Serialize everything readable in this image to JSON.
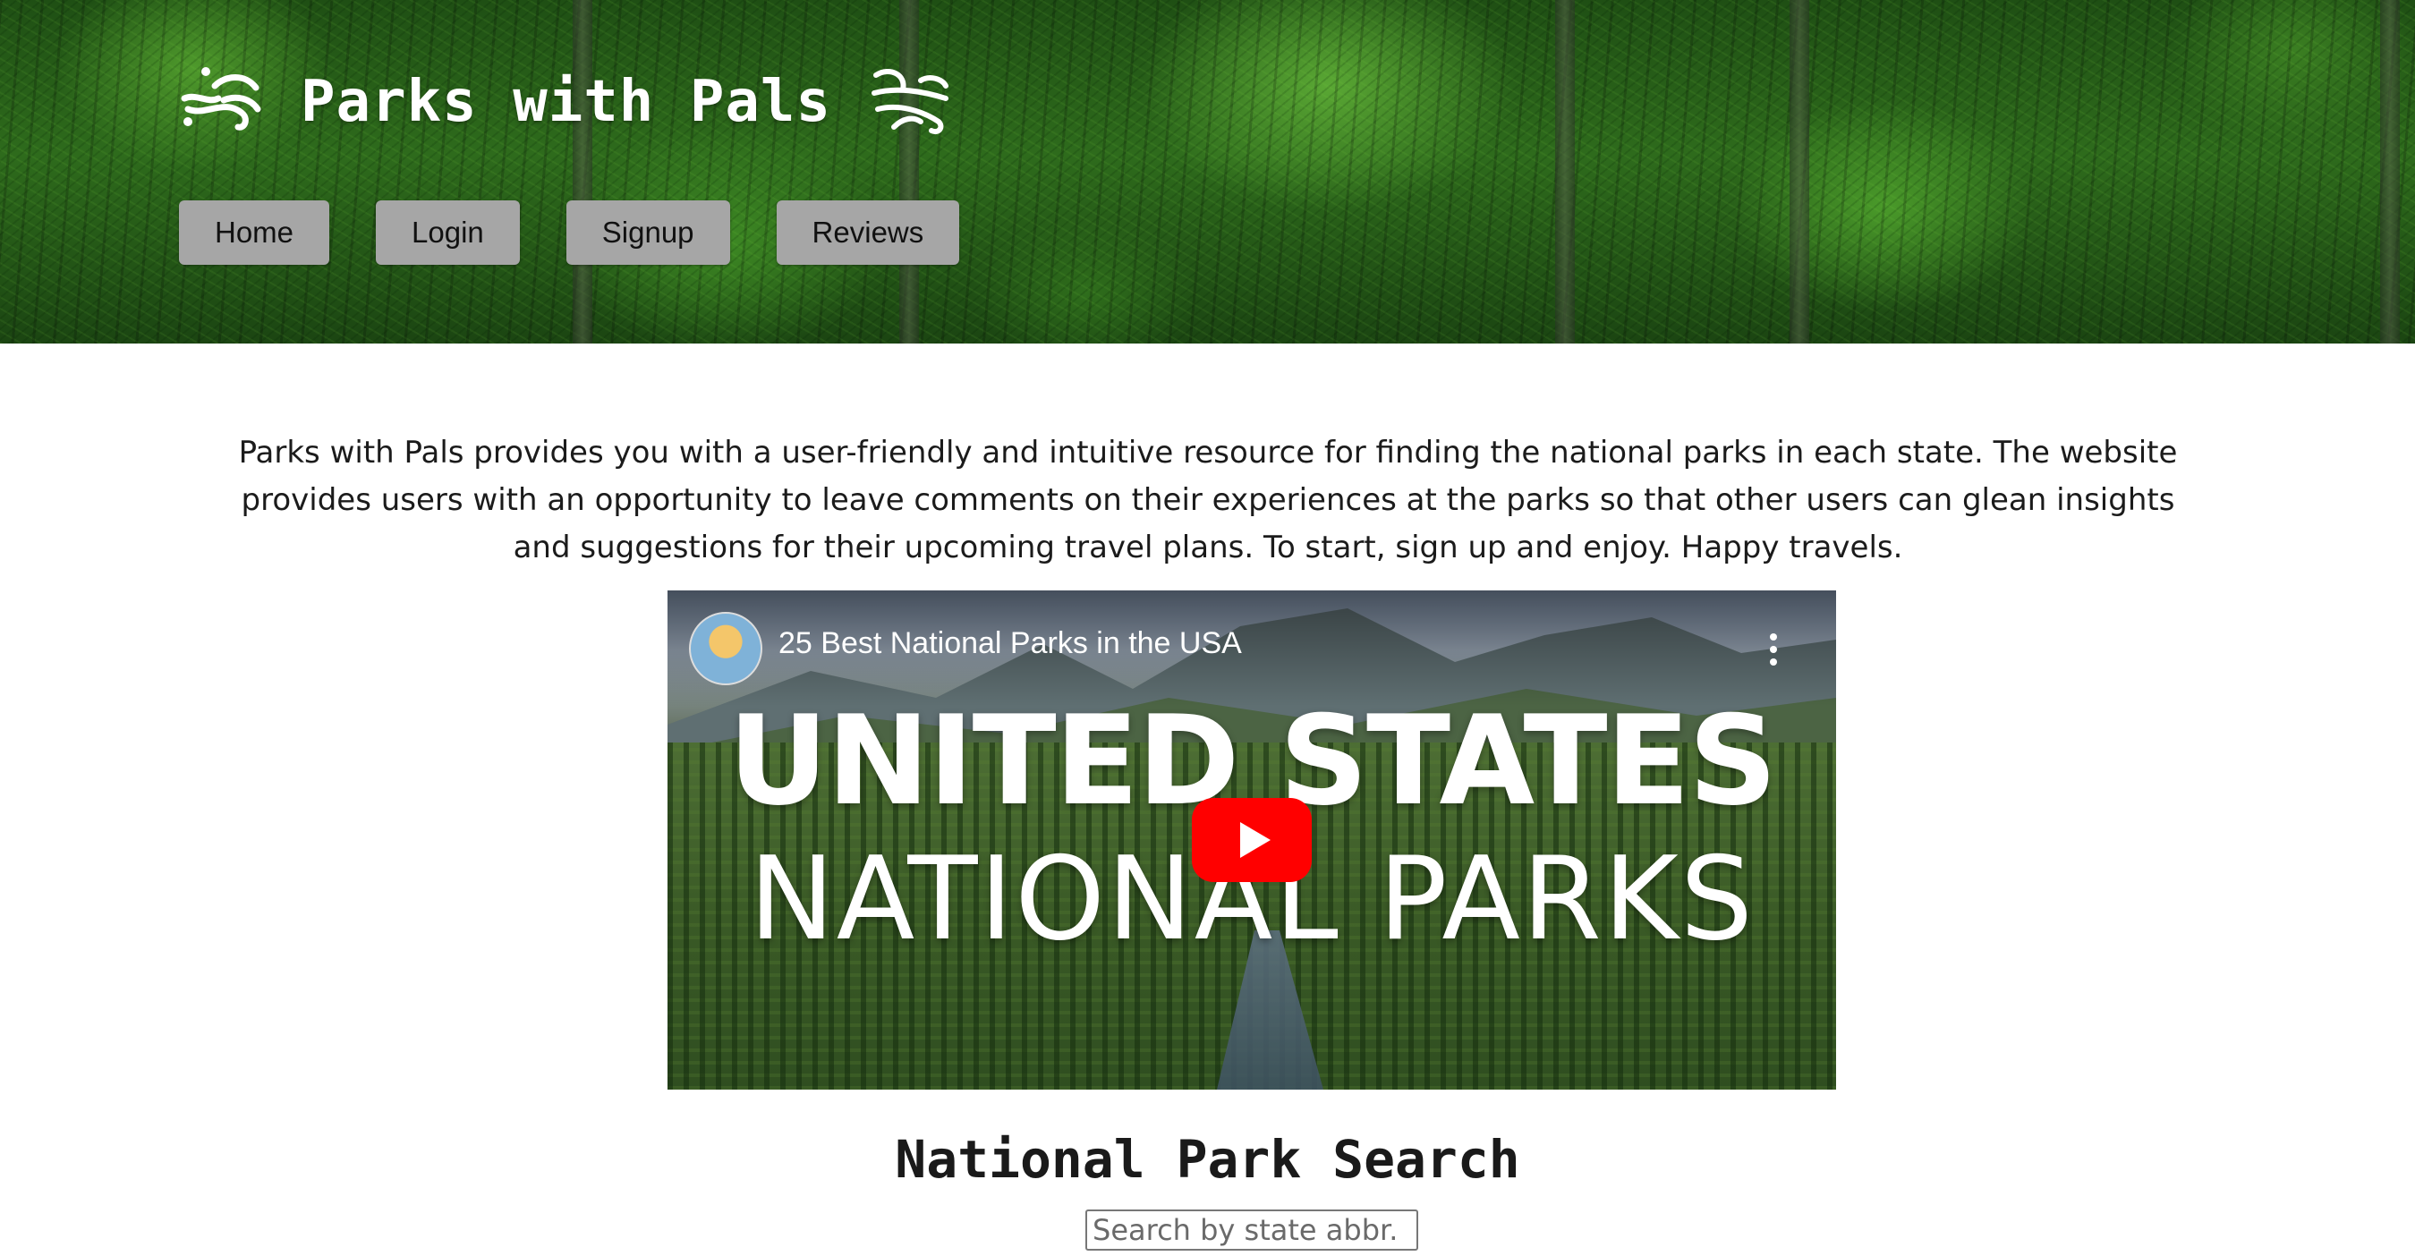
{
  "header": {
    "title": "Parks with Pals",
    "icon_left": "wind-swirl-icon",
    "icon_right": "wind-swirl-icon",
    "nav": [
      {
        "label": "Home"
      },
      {
        "label": "Login"
      },
      {
        "label": "Signup"
      },
      {
        "label": "Reviews"
      }
    ]
  },
  "intro": {
    "text": "Parks with Pals provides you with a user-friendly and intuitive resource for finding the national parks in each state. The website provides users with an opportunity to leave comments on their experiences at the parks so that other users can glean insights and suggestions for their upcoming travel plans. To start, sign up and enjoy. Happy travels."
  },
  "video": {
    "title": "25 Best National Parks in the USA",
    "thumbnail_line1": "UNITED STATES",
    "thumbnail_line2": "NATIONAL PARKS",
    "play_color": "#ff0000"
  },
  "search": {
    "heading": "National Park Search",
    "placeholder": "Search by state abbr.",
    "value": ""
  }
}
